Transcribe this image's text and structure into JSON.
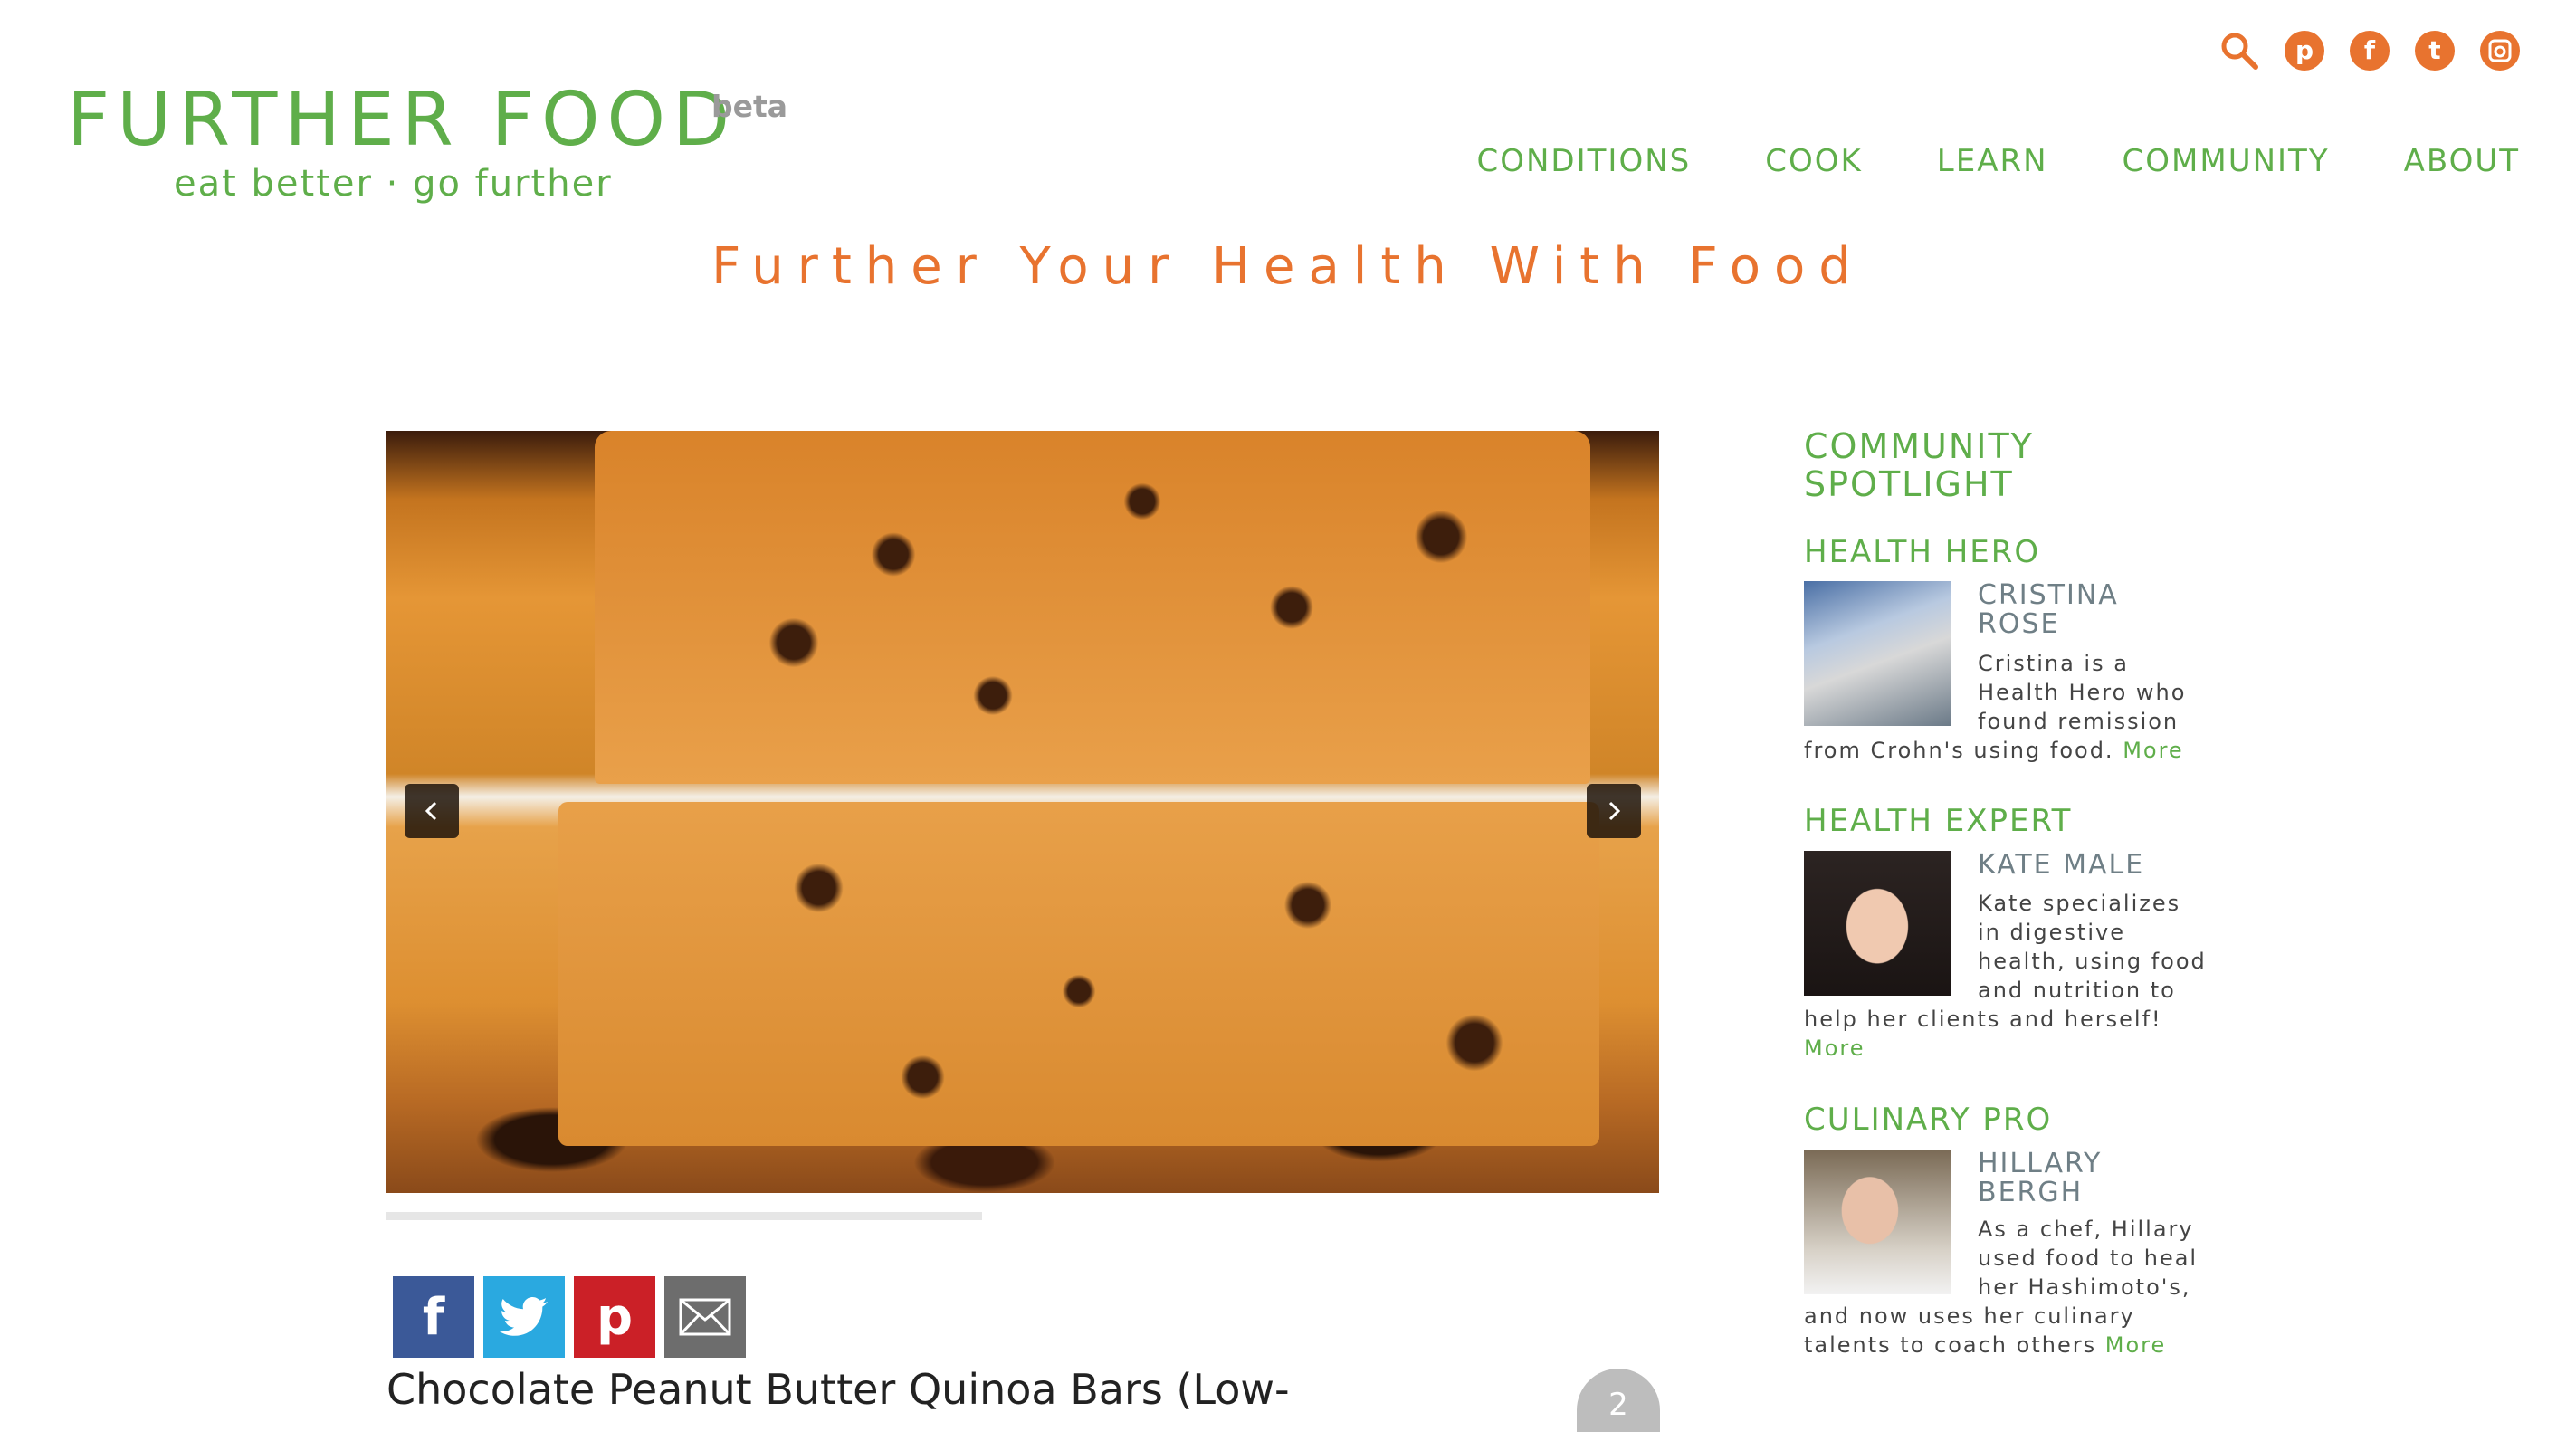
{
  "header": {
    "logo_title": "FURTHER FOOD",
    "logo_badge": "beta",
    "tagline": "eat better · go further",
    "social_icons": [
      "search-icon",
      "pinterest-icon",
      "facebook-icon",
      "twitter-icon",
      "instagram-icon"
    ],
    "nav": [
      "CONDITIONS",
      "COOK",
      "LEARN",
      "COMMUNITY",
      "ABOUT"
    ]
  },
  "headline": "Further Your Health With Food",
  "carousel": {
    "prev_icon": "chevron-left-icon",
    "next_icon": "chevron-right-icon"
  },
  "share": {
    "buttons": [
      "facebook-icon",
      "twitter-icon",
      "pinterest-icon",
      "email-icon"
    ]
  },
  "article": {
    "title": "Chocolate Peanut Butter Quinoa Bars (Low-",
    "like_count": "2"
  },
  "sidebar": {
    "heading_line1": "COMMUNITY",
    "heading_line2": "SPOTLIGHT",
    "hero": {
      "category": "HEALTH HERO",
      "name_line1": "CRISTINA",
      "name_line2": "ROSE",
      "desc_indented": [
        "Cristina is a",
        "Health Hero who",
        "found remission"
      ],
      "desc_full": "from Crohn's using food.",
      "more": "More"
    },
    "expert": {
      "category": "HEALTH EXPERT",
      "name_line1": "KATE MALE",
      "desc_indented": [
        "Kate specializes",
        "in digestive",
        "health, using food",
        "and nutrition to"
      ],
      "desc_full": "help her clients and herself!",
      "more": "More"
    },
    "pro": {
      "category": "CULINARY PRO",
      "name_line1": "HILLARY",
      "name_line2": "BERGH",
      "desc_indented": [
        "As a chef, Hillary",
        "used food to heal",
        "her Hashimoto's,"
      ],
      "desc_full_1": "and now uses her culinary",
      "desc_full_2": "talents to coach others",
      "more": "More"
    }
  },
  "colors": {
    "brand_green": "#5fae4a",
    "accent_orange": "#e8732f"
  }
}
